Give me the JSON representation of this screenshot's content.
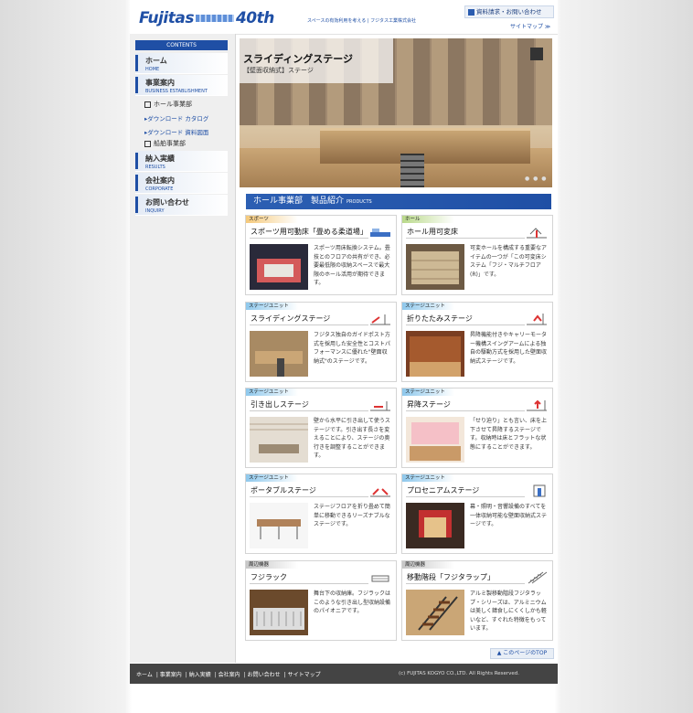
{
  "header": {
    "brand": "Fujitas",
    "anniversary": "40th",
    "tagline": "スペースの有効利用を考える | フジタス工業株式会社",
    "doc_request": "資料請求・お問い合わせ",
    "sitemap": "サイトマップ ≫"
  },
  "sidebar": {
    "contents_label": "CONTENTS",
    "nav": [
      {
        "jp": "ホーム",
        "en": "HOME"
      },
      {
        "jp": "事業案内",
        "en": "BUSINESS ESTABLISHMENT"
      },
      {
        "jp": "納入実績",
        "en": "RESULTS"
      },
      {
        "jp": "会社案内",
        "en": "CORPORATE"
      },
      {
        "jp": "お問い合わせ",
        "en": "INQUIRY"
      }
    ],
    "sub": {
      "hall": "ホール事業部",
      "download_catalog": "ダウンロード カタログ",
      "download_drawing": "ダウンロード 資料図面",
      "ship": "船舶事業部"
    }
  },
  "hero": {
    "title": "スライディングステージ",
    "subtitle": "【壁面収納式】ステージ",
    "dots": "● ● ●"
  },
  "section": {
    "title": "ホール事業部　製品紹介",
    "sub": "PRODUCTS"
  },
  "cards": [
    {
      "tag": "スポーツ",
      "title": "スポーツ用可動床「畳める柔道場」",
      "desc": "スポーツ用床転換システム。畳技とのフロアの共有ができ、必要最低限の収納スペースで最大限のホール活用が期待できます。"
    },
    {
      "tag": "ホール",
      "title": "ホール用可変床",
      "desc": "可変ホールを構成する重要なアイテムの一つが「この可変床システム「フジ・マルチフロア(R)」です。"
    },
    {
      "tag": "ステージユニット",
      "title": "スライディングステージ",
      "desc": "フジタス独自のガイドポスト方式を採用した安全性とコストパフォーマンスに優れた\"壁面収納式\"のステージです。"
    },
    {
      "tag": "ステージユニット",
      "title": "折りたたみステージ",
      "desc": "昇降機能付きやキャリーモーター機構スイングアームによる独自の駆動方式を採用した壁面収納式ステージです。"
    },
    {
      "tag": "ステージユニット",
      "title": "引き出しステージ",
      "desc": "壁から水平に引き出して使うステージです。引き出す長さを変えることにより、ステージの奥行きを調整することができます。"
    },
    {
      "tag": "ステージユニット",
      "title": "昇降ステージ",
      "desc": "「せり迫り」とも言い、床を上下させて昇降するステージです。収納時は床とフラットな状態にすることができます。"
    },
    {
      "tag": "ステージユニット",
      "title": "ポータブルステージ",
      "desc": "ステージフロアを折り畳めて簡単に移動できるリーズナブルなステージです。"
    },
    {
      "tag": "ステージユニット",
      "title": "プロセニアムステージ",
      "desc": "幕・照明・音響設備のすべてを一体収納可能な壁面収納式ステージです。"
    },
    {
      "tag": "周辺機器",
      "title": "フジラック",
      "desc": "舞台下の収納庫。フジラックはこのような引き出し型収納設備のパイオニアです。"
    },
    {
      "tag": "周辺機器",
      "title": "移動階段「フジタラップ」",
      "desc": "アルミ製移動階段フジタラップ・シリーズは、アルミニウムは美しく錆食しにくくしかも軽いなど、すぐれた特徴をもっています。"
    }
  ],
  "toplink": "▲ このページのTOP",
  "footer": {
    "links": [
      "ホーム",
      "事業案内",
      "納入実績",
      "会社案内",
      "お問い合わせ",
      "サイトマップ"
    ],
    "copyright": "(c) FUJITAS KOGYO CO.,LTD. All Rights Reserved."
  }
}
